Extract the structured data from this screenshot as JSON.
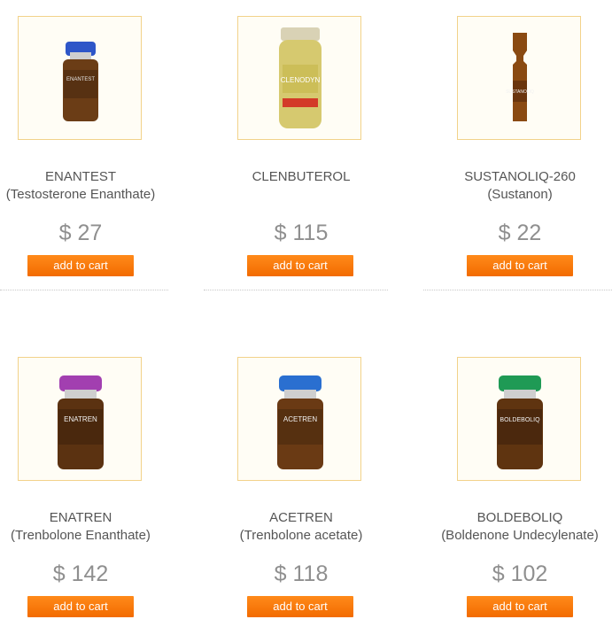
{
  "products": [
    {
      "name": "ENANTEST",
      "subtitle": "(Testosterone Enanthate)",
      "price": "$ 27",
      "button_label": "add to cart",
      "image_icon": "vial-icon",
      "cap_color": "#2e56c8",
      "label_text": "ENANTEST"
    },
    {
      "name": "CLENBUTEROL",
      "subtitle": "",
      "price": "$ 115",
      "button_label": "add to cart",
      "image_icon": "tablet-bottle-icon",
      "cap_color": "#d9d2b5",
      "label_text": "CLENODYN"
    },
    {
      "name": "SUSTANOLIQ-260",
      "subtitle": "(Sustanon)",
      "price": "$ 22",
      "button_label": "add to cart",
      "image_icon": "ampoule-icon",
      "cap_color": "#8a4a12",
      "label_text": "SUSTANOLIQ"
    },
    {
      "name": "ENATREN",
      "subtitle": "(Trenbolone Enanthate)",
      "price": "$ 142",
      "button_label": "add to cart",
      "image_icon": "vial-icon",
      "cap_color": "#a23fb0",
      "label_text": "ENATREN"
    },
    {
      "name": "ACETREN",
      "subtitle": "(Trenbolone acetate)",
      "price": "$ 118",
      "button_label": "add to cart",
      "image_icon": "vial-icon",
      "cap_color": "#2a6fd0",
      "label_text": "ACETREN"
    },
    {
      "name": "BOLDEBOLIQ",
      "subtitle": "(Boldenone Undecylenate)",
      "price": "$ 102",
      "button_label": "add to cart",
      "image_icon": "vial-icon",
      "cap_color": "#1f9a55",
      "label_text": "BOLDEBOLIQ"
    }
  ],
  "colors": {
    "button": "#f57400",
    "price": "#8f8f8f",
    "text": "#555555",
    "thumb_border": "#f2d28a"
  }
}
